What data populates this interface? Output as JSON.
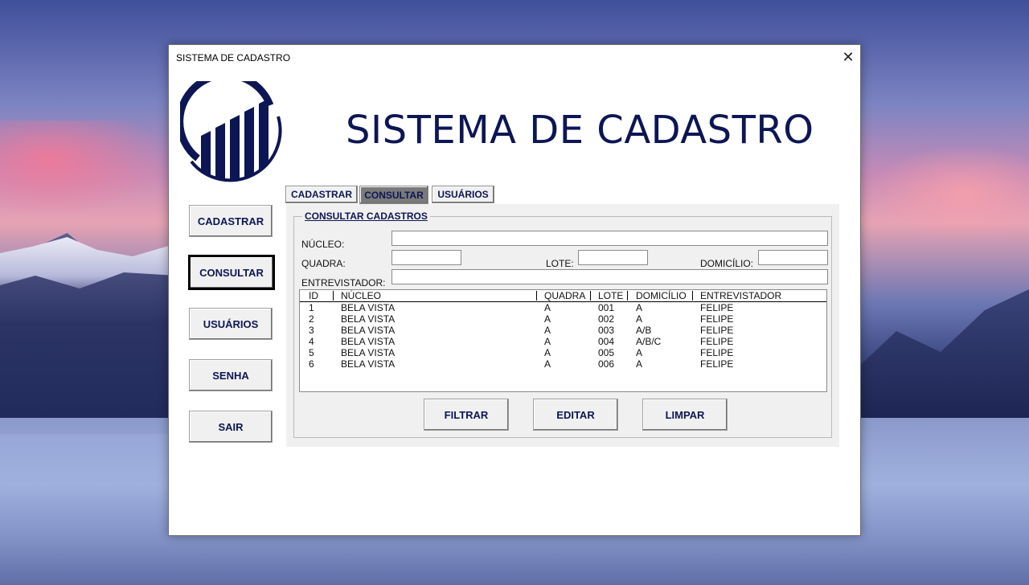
{
  "window": {
    "title": "SISTEMA DE CADASTRO"
  },
  "header": {
    "title": "SISTEMA DE CADASTRO"
  },
  "sidebar": {
    "items": [
      {
        "label": "CADASTRAR"
      },
      {
        "label": "CONSULTAR",
        "active": true
      },
      {
        "label": "USUÁRIOS"
      },
      {
        "label": "SENHA"
      },
      {
        "label": "SAIR"
      }
    ]
  },
  "tabs": [
    {
      "label": "CADASTRAR"
    },
    {
      "label": "CONSULTAR",
      "active": true
    },
    {
      "label": "USUÁRIOS"
    }
  ],
  "consultar": {
    "group_title": "CONSULTAR CADASTROS",
    "fields": {
      "nucleo": {
        "label": "NÚCLEO:",
        "value": ""
      },
      "quadra": {
        "label": "QUADRA:",
        "value": ""
      },
      "lote": {
        "label": "LOTE:",
        "value": ""
      },
      "domicilio": {
        "label": "DOMICÍLIO:",
        "value": ""
      },
      "entrevistador": {
        "label": "ENTREVISTADOR:",
        "value": ""
      }
    },
    "table": {
      "columns": [
        "ID",
        "NÚCLEO",
        "QUADRA",
        "LOTE",
        "DOMICÍLIO",
        "ENTREVISTADOR"
      ],
      "rows": [
        [
          "1",
          "BELA VISTA",
          "A",
          "001",
          "A",
          "FELIPE"
        ],
        [
          "2",
          "BELA VISTA",
          "A",
          "002",
          "A",
          "FELIPE"
        ],
        [
          "3",
          "BELA VISTA",
          "A",
          "003",
          "A/B",
          "FELIPE"
        ],
        [
          "4",
          "BELA VISTA",
          "A",
          "004",
          "A/B/C",
          "FELIPE"
        ],
        [
          "5",
          "BELA VISTA",
          "A",
          "005",
          "A",
          "FELIPE"
        ],
        [
          "6",
          "BELA VISTA",
          "A",
          "006",
          "A",
          "FELIPE"
        ]
      ]
    },
    "buttons": {
      "filtrar": "FILTRAR",
      "editar": "EDITAR",
      "limpar": "LIMPAR"
    }
  },
  "colors": {
    "brand": "#0d1654",
    "window_bg": "#ffffff",
    "panel_bg": "#f0f0f0"
  },
  "icons": {
    "close": "close-icon",
    "logo": "bar-chart-logo-icon"
  }
}
